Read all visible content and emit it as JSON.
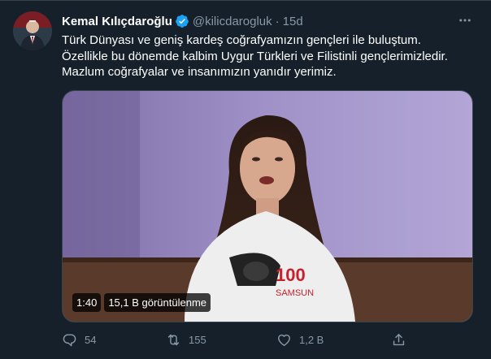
{
  "tweet": {
    "author_name": "Kemal Kılıçdaroğlu",
    "handle": "@kilicdarogluk",
    "separator": "·",
    "time": "15d",
    "lines": [
      "Türk Dünyası ve geniş kardeş coğrafyamızın gençleri ile buluştum.",
      "Özellikle bu dönemde kalbim Uygur Türkleri ve Filistinli gençlerimizledir.",
      "Mazlum coğrafyalar ve insanımızın yanıdır yerimiz."
    ],
    "video": {
      "duration": "1:40",
      "views": "15,1 B görüntülenme",
      "shirt_text": "SAMSUN",
      "shirt_number": "100"
    },
    "actions": {
      "reply_count": "54",
      "retweet_count": "155",
      "like_count": "1,2 B"
    }
  },
  "colors": {
    "background": "#15202b",
    "secondary_text": "#8899a6",
    "verified": "#1da1f2",
    "border": "#38444d"
  },
  "icons": {
    "verified": "verified-badge-icon",
    "more": "more-icon",
    "reply": "reply-icon",
    "retweet": "retweet-icon",
    "like": "heart-icon",
    "share": "share-icon"
  }
}
